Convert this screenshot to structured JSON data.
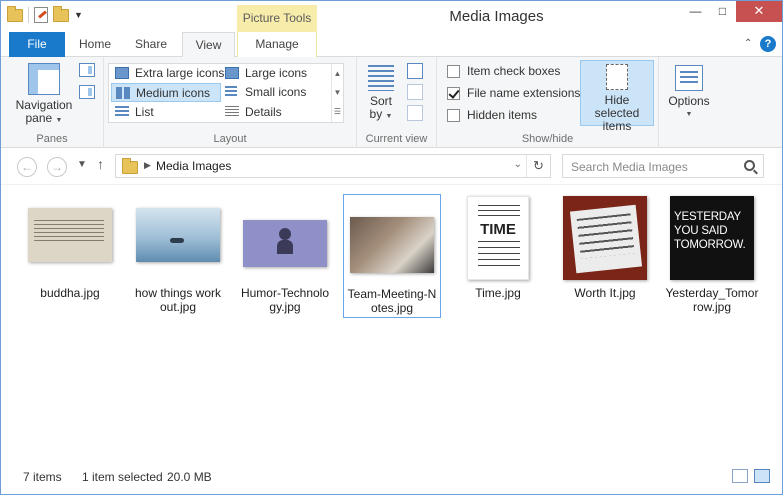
{
  "window": {
    "title": "Media Images"
  },
  "qat": {
    "icons": [
      "folder-icon",
      "properties-icon",
      "new-folder-icon",
      "customize-qat-icon"
    ]
  },
  "ribbon": {
    "context_header": "Picture Tools",
    "tabs": {
      "file": "File",
      "home": "Home",
      "share": "Share",
      "view": "View",
      "manage": "Manage"
    },
    "panes": {
      "label": "Panes",
      "navigation_pane_line1": "Navigation",
      "navigation_pane_line2": "pane"
    },
    "layout": {
      "label": "Layout",
      "items": {
        "extra_large": "Extra large icons",
        "large": "Large icons",
        "medium": "Medium icons",
        "small": "Small icons",
        "list": "List",
        "details": "Details"
      },
      "selected": "Medium icons"
    },
    "current_view": {
      "label": "Current view",
      "sort_by_line1": "Sort",
      "sort_by_line2": "by"
    },
    "show_hide": {
      "label": "Show/hide",
      "item_check_boxes": {
        "label": "Item check boxes",
        "checked": false
      },
      "file_name_extensions": {
        "label": "File name extensions",
        "checked": true
      },
      "hidden_items": {
        "label": "Hidden items",
        "checked": false
      },
      "hide_selected_line1": "Hide selected",
      "hide_selected_line2": "items"
    },
    "options": {
      "label": "Options"
    }
  },
  "address": {
    "path": "Media Images",
    "search_placeholder": "Search Media Images"
  },
  "files": [
    {
      "label": "buddha.jpg",
      "selected": false
    },
    {
      "label": "how things work out.jpg",
      "selected": false
    },
    {
      "label": "Humor-Technology.jpg",
      "selected": false
    },
    {
      "label": "Team-Meeting-Notes.jpg",
      "selected": true
    },
    {
      "label": "Time.jpg",
      "selected": false
    },
    {
      "label": "Worth It.jpg",
      "selected": false
    },
    {
      "label": "Yesterday_Tomorrow.jpg",
      "selected": false
    }
  ],
  "thumbnails": {
    "yesterday_text": "YESTERDAY YOU SAID TOMORROW.",
    "time_text": "TIME"
  },
  "status": {
    "item_count": "7 items",
    "selection": "1 item selected",
    "size": "20.0 MB"
  },
  "colors": {
    "file_tab": "#1979ca",
    "picture_tools": "#f7ecaa",
    "selection": "#cce4f7",
    "close_button": "#c75050"
  }
}
